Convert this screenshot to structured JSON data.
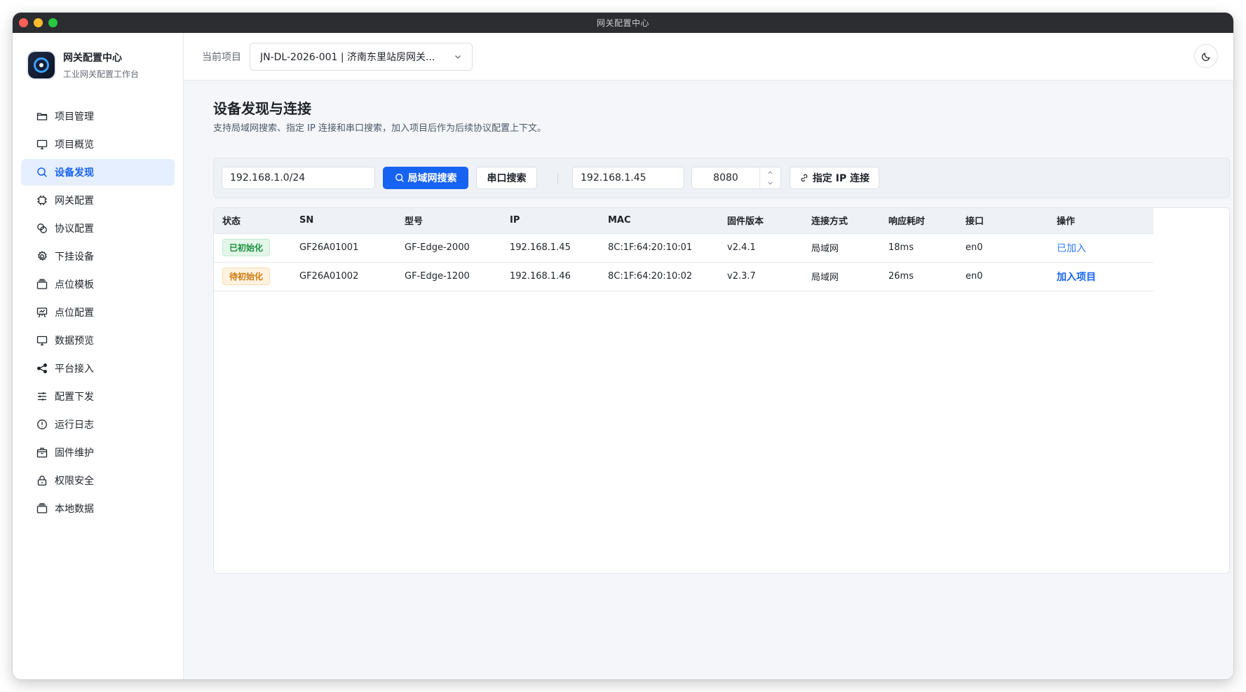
{
  "window": {
    "title": "网关配置中心"
  },
  "brand": {
    "name": "网关配置中心",
    "subtitle": "工业网关配置工作台"
  },
  "sidebar": {
    "items": [
      {
        "label": "项目管理",
        "icon": "folder-icon",
        "active": false
      },
      {
        "label": "项目概览",
        "icon": "monitor-icon",
        "active": false
      },
      {
        "label": "设备发现",
        "icon": "search-icon",
        "active": true
      },
      {
        "label": "网关配置",
        "icon": "chip-icon",
        "active": false
      },
      {
        "label": "协议配置",
        "icon": "link-circles-icon",
        "active": false
      },
      {
        "label": "下挂设备",
        "icon": "gear-icon",
        "active": false
      },
      {
        "label": "点位模板",
        "icon": "stack-icon",
        "active": false
      },
      {
        "label": "点位配置",
        "icon": "easel-icon",
        "active": false
      },
      {
        "label": "数据预览",
        "icon": "monitor-icon",
        "active": false
      },
      {
        "label": "平台接入",
        "icon": "share-icon",
        "active": false
      },
      {
        "label": "配置下发",
        "icon": "sliders-icon",
        "active": false
      },
      {
        "label": "运行日志",
        "icon": "alert-circle-icon",
        "active": false
      },
      {
        "label": "固件维护",
        "icon": "package-icon",
        "active": false
      },
      {
        "label": "权限安全",
        "icon": "lock-icon",
        "active": false
      },
      {
        "label": "本地数据",
        "icon": "stack-icon",
        "active": false
      }
    ]
  },
  "header": {
    "project_label": "当前项目",
    "project_value": "JN-DL-2026-001 | 济南东里站房网关...",
    "theme_icon": "moon-icon"
  },
  "page": {
    "title": "设备发现与连接",
    "description": "支持局域网搜索、指定 IP 连接和串口搜索，加入项目后作为后续协议配置上下文。"
  },
  "toolbar": {
    "subnet_value": "192.168.1.0/24",
    "lan_search_label": "局域网搜索",
    "serial_search_label": "串口搜索",
    "ip_value": "192.168.1.45",
    "port_value": "8080",
    "connect_label": "指定 IP 连接"
  },
  "table": {
    "columns": [
      "状态",
      "SN",
      "型号",
      "IP",
      "MAC",
      "固件版本",
      "连接方式",
      "响应耗时",
      "接口",
      "操作"
    ],
    "rows": [
      {
        "status": "已初始化",
        "status_color": "#1a8f3f",
        "sn": "GF26A01001",
        "model": "GF-Edge-2000",
        "ip": "192.168.1.45",
        "mac": "8C:1F:64:20:10:01",
        "firmware": "v2.4.1",
        "conn": "局域网",
        "latency": "18ms",
        "iface": "en0",
        "action": "已加入"
      },
      {
        "status": "待初始化",
        "status_color": "#cc7a0c",
        "sn": "GF26A01002",
        "model": "GF-Edge-1200",
        "ip": "192.168.1.46",
        "mac": "8C:1F:64:20:10:02",
        "firmware": "v2.3.7",
        "conn": "局域网",
        "latency": "26ms",
        "iface": "en0",
        "action": "加入项目"
      }
    ]
  },
  "colors": {
    "accent": "#1763f1",
    "active_bg": "#e5efff"
  }
}
